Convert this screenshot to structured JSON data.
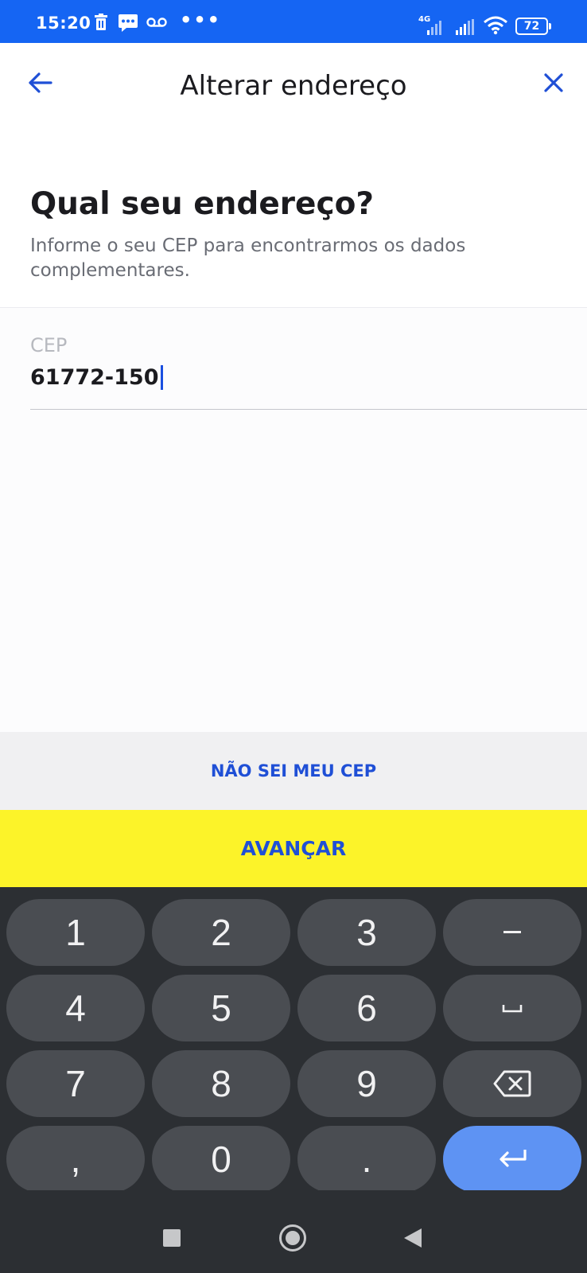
{
  "status_bar": {
    "time": "15:20",
    "dots": "•••",
    "network": "4G",
    "battery": "72"
  },
  "header": {
    "title": "Alterar endereço",
    "back_icon": "arrow-left-icon",
    "close_icon": "close-icon"
  },
  "main": {
    "heading": "Qual seu endereço?",
    "subheading": "Informe o seu CEP para encontrarmos os dados complementares.",
    "cep_label": "CEP",
    "cep_value": "61772-150"
  },
  "actions": {
    "secondary_label": "NÃO SEI MEU CEP",
    "primary_label": "AVANÇAR"
  },
  "keyboard": {
    "keys": [
      "1",
      "2",
      "3",
      "–",
      "4",
      "5",
      "6",
      "␣",
      "7",
      "8",
      "9",
      "⌫",
      ",",
      "0",
      ".",
      "↵"
    ]
  },
  "colors": {
    "status_bar": "#1565f3",
    "accent_blue": "#1f4fd6",
    "primary_button": "#fcf329",
    "keyboard_bg": "#2c2f33",
    "enter_key": "#5e93f3"
  }
}
